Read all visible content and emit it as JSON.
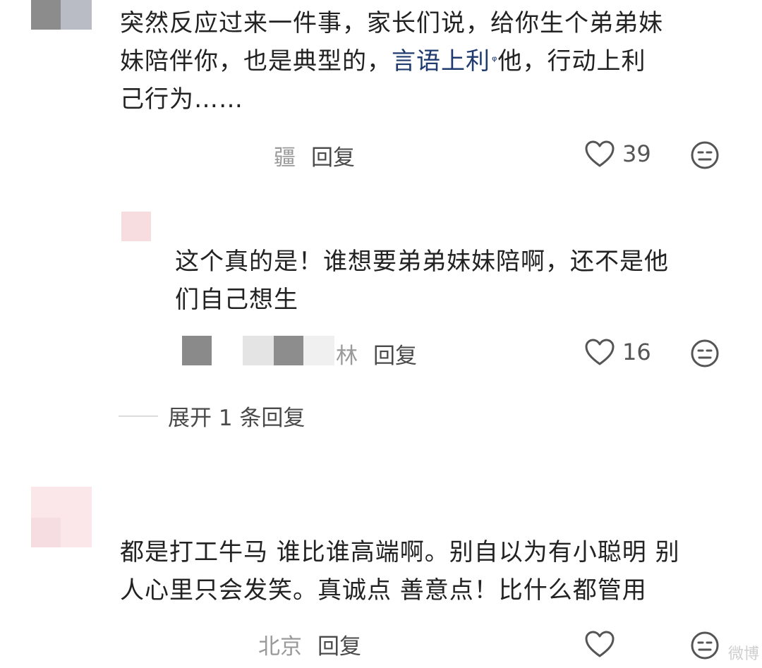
{
  "comment1": {
    "text_line1": "突然反应过来一件事，家长们说，给你生个弟弟妹",
    "text_line2_before": "妹陪伴你，也是典型的，",
    "topic_link": "言语上利",
    "search_mark": "ᵠ",
    "text_line2_after": "他，行动上利",
    "text_line3": "己行为……",
    "location": "疆",
    "reply_label": "回复",
    "likes": "39"
  },
  "reply1": {
    "text_line1": "这个真的是！谁想要弟弟妹妹陪啊，还不是他",
    "text_line2": "们自己想生",
    "location": "林",
    "reply_label": "回复",
    "likes": "16"
  },
  "expand_replies": {
    "label": "展开 1 条回复"
  },
  "comment2": {
    "text_line1": "都是打工牛马 谁比谁高端啊。别自以为有小聪明 别",
    "text_line2": "人心里只会发笑。真诚点 善意点！比什么都管用",
    "location": "北京",
    "reply_label": "回复"
  },
  "watermark": {
    "text": "微博"
  },
  "colors": {
    "topic_link": "#1e3a6e",
    "meta_gray": "#9a9a9a",
    "reply_gray": "#4a4a4a"
  },
  "icons": {
    "like": "heart-outline-icon",
    "dislike": "neutral-face-icon"
  }
}
